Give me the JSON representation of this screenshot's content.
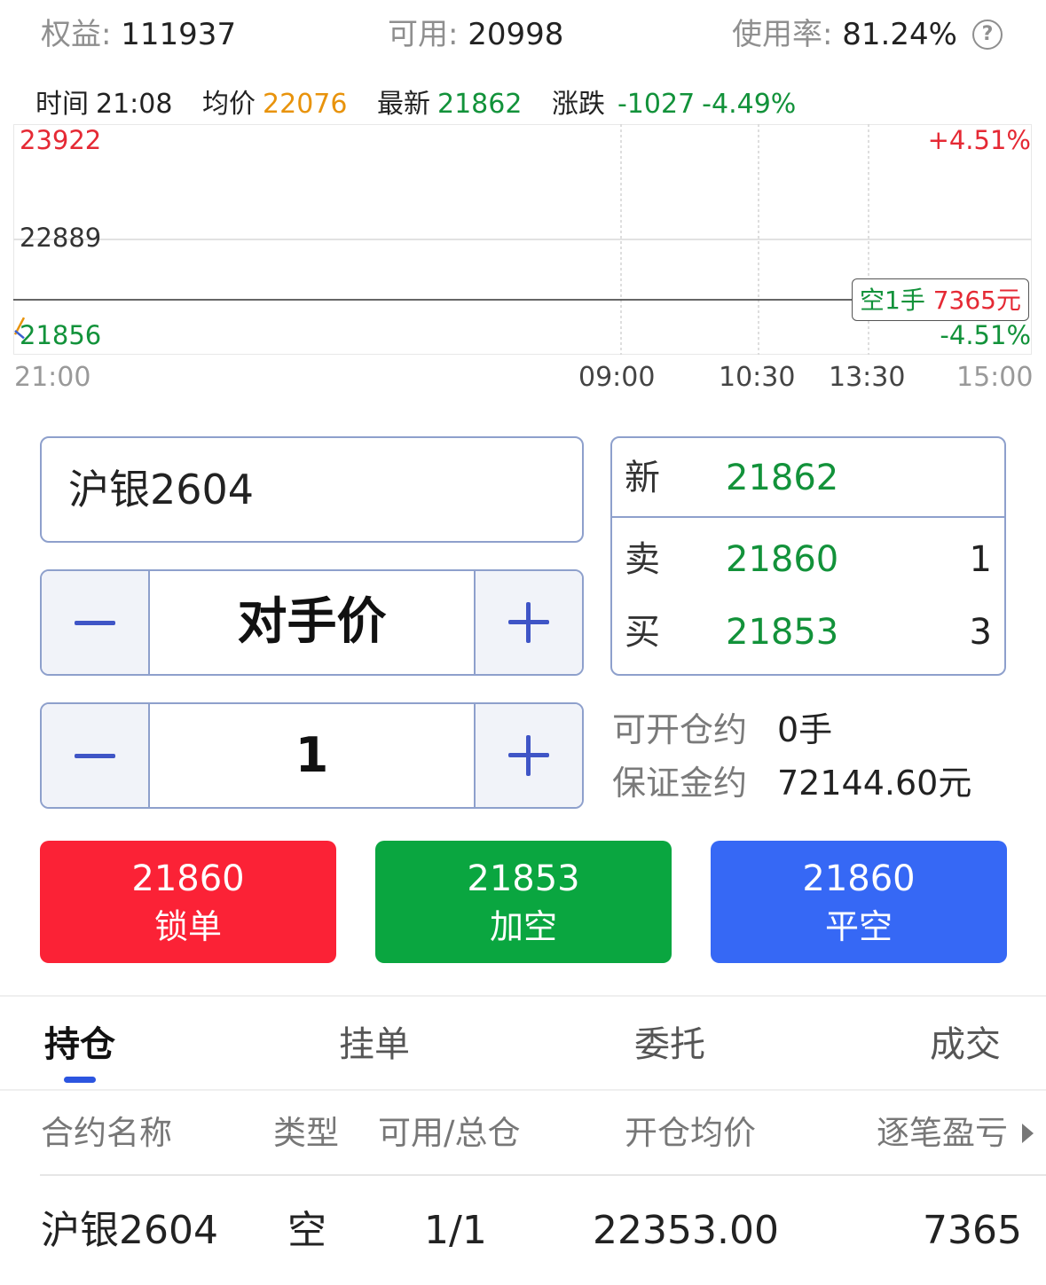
{
  "account": {
    "equity_label": "权益:",
    "equity": "111937",
    "available_label": "可用:",
    "available": "20998",
    "usage_label": "使用率:",
    "usage": "81.24%",
    "help_icon": "?"
  },
  "quote": {
    "time_label": "时间",
    "time": "21:08",
    "avg_label": "均价",
    "avg": "22076",
    "last_label": "最新",
    "last": "21862",
    "change_label": "涨跌",
    "change": "-1027",
    "change_pct": "-4.49%"
  },
  "chart": {
    "y_top": "23922",
    "y_mid": "22889",
    "y_bottom": "21856",
    "pct_top": "+4.51%",
    "pct_bottom": "-4.51%",
    "x_labels": [
      "21:00",
      "09:00",
      "10:30",
      "13:30",
      "15:00"
    ],
    "position_tag_prefix": "空1手 ",
    "position_tag_value": "7365元",
    "colors": {
      "up": "#e52934",
      "down": "#12923a",
      "avg": "#e8930c"
    }
  },
  "chart_data": {
    "type": "line",
    "x": [
      "21:00",
      "21:08"
    ],
    "series": [
      {
        "name": "最新",
        "values": [
          21940,
          21862
        ]
      },
      {
        "name": "均价",
        "values": [
          21900,
          22076
        ]
      }
    ],
    "ylim": [
      21856,
      23922
    ],
    "reference_line": 22889,
    "position_line": 22353,
    "x_ticks": [
      "21:00",
      "09:00",
      "10:30",
      "13:30",
      "15:00"
    ]
  },
  "order": {
    "symbol": "沪银2604",
    "price_mode": "对手价",
    "quantity": "1",
    "book": {
      "new_label": "新",
      "new_price": "21862",
      "ask_label": "卖",
      "ask_price": "21860",
      "ask_qty": "1",
      "bid_label": "买",
      "bid_price": "21853",
      "bid_qty": "3"
    },
    "open_label": "可开仓约",
    "open_value": "0手",
    "margin_label": "保证金约",
    "margin_value": "72144.60元"
  },
  "actions": [
    {
      "price": "21860",
      "label": "锁单",
      "color": "#fb2236"
    },
    {
      "price": "21853",
      "label": "加空",
      "color": "#0aa640"
    },
    {
      "price": "21860",
      "label": "平空",
      "color": "#3668f5"
    }
  ],
  "tabs": [
    "持仓",
    "挂单",
    "委托",
    "成交"
  ],
  "positions": {
    "headers": [
      "合约名称",
      "类型",
      "可用/总仓",
      "开仓均价",
      "逐笔盈亏"
    ],
    "rows": [
      {
        "name": "沪银2604",
        "type": "空",
        "avail_total": "1/1",
        "avg_price": "22353.00",
        "pnl": "7365"
      }
    ]
  }
}
